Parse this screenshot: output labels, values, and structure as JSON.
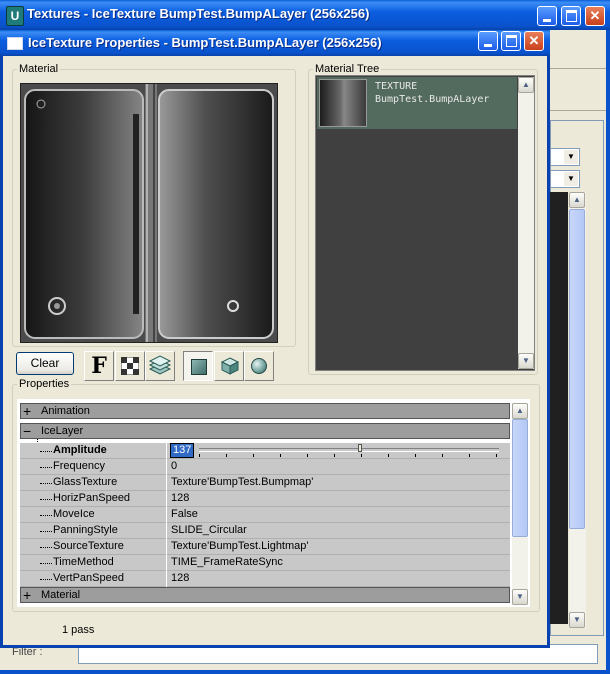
{
  "back_window": {
    "title": "Textures - IceTexture BumpTest.BumpALayer (256x256)",
    "filter_label": "Filter :"
  },
  "dialog": {
    "title": "IceTexture Properties - BumpTest.BumpALayer (256x256)"
  },
  "material_group": {
    "legend": "Material"
  },
  "material_tree": {
    "legend": "Material Tree",
    "node_type": "TEXTURE",
    "node_name": "BumpTest.BumpALayer"
  },
  "toolbar": {
    "clear_label": "Clear",
    "font_glyph": "F"
  },
  "properties": {
    "legend": "Properties",
    "categories": [
      {
        "label": "Animation",
        "expanded": false
      },
      {
        "label": "IceLayer",
        "expanded": true
      },
      {
        "label": "Material",
        "expanded": false
      }
    ],
    "icelayer_rows": [
      {
        "name": "Amplitude",
        "value": "137",
        "selected": true
      },
      {
        "name": "Frequency",
        "value": "0"
      },
      {
        "name": "GlassTexture",
        "value": "Texture'BumpTest.Bumpmap'"
      },
      {
        "name": "HorizPanSpeed",
        "value": "128"
      },
      {
        "name": "MoveIce",
        "value": "False"
      },
      {
        "name": "PanningStyle",
        "value": "SLIDE_Circular"
      },
      {
        "name": "SourceTexture",
        "value": "Texture'BumpTest.Lightmap'"
      },
      {
        "name": "TimeMethod",
        "value": "TIME_FrameRateSync"
      },
      {
        "name": "VertPanSpeed",
        "value": "128"
      }
    ],
    "amplitude_slider_fraction": 0.53
  },
  "status": {
    "text": "1 pass"
  },
  "colors": {
    "titlebar_blue": "#0a52cc",
    "tree_bg": "#404040",
    "tree_selected": "#536b5e",
    "grid_row": "#c8c8c8",
    "category_row": "#9d9d9d"
  }
}
